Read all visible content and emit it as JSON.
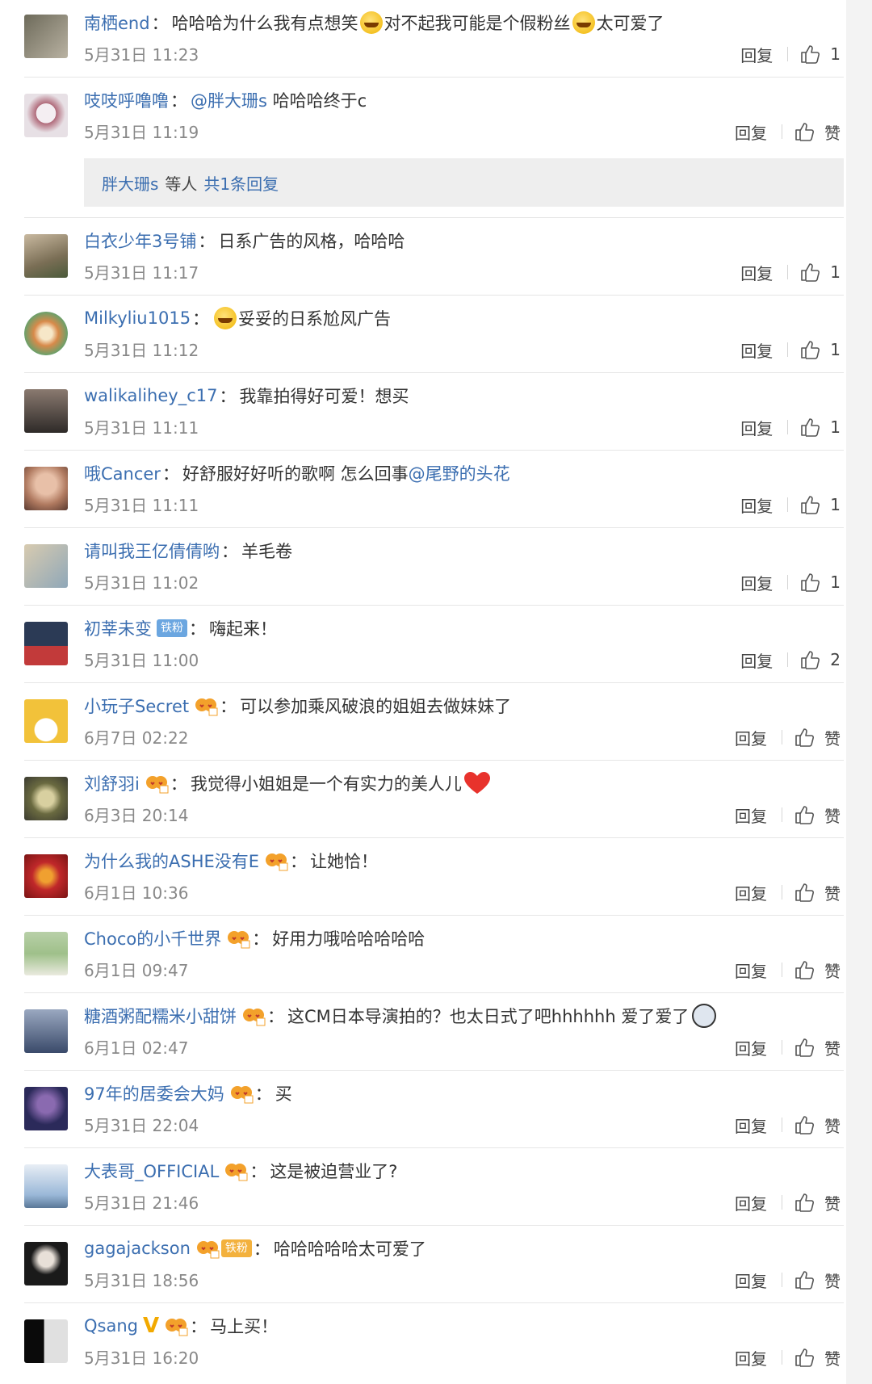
{
  "ui": {
    "reply_label": "回复",
    "like_label": "赞"
  },
  "comments": [
    {
      "user": "南栖end",
      "text": "哈哈哈为什么我有点想笑",
      "text2": "对不起我可能是个假粉丝",
      "text3": "太可爱了",
      "time": "5月31日 11:23",
      "likes": "1",
      "avatar": [
        "#6d6a5a",
        "#b9b2a2"
      ]
    },
    {
      "user": "吱吱呼噜噜",
      "mention": "@胖大珊s",
      "text": " 哈哈哈终于c",
      "time": "5月31日 11:19",
      "likes": "赞",
      "avatar": [
        "#e7e0e5",
        "#b06a7a"
      ],
      "subreply": {
        "user": "胖大珊s",
        "mid": "等人",
        "link": "共1条回复"
      }
    },
    {
      "user": "白衣少年3号铺",
      "text": "日系广告的风格，哈哈哈",
      "time": "5月31日 11:17",
      "likes": "1",
      "avatar": [
        "#7a6e55",
        "#c9b9a0"
      ]
    },
    {
      "user": "Milkyliu1015",
      "text": "妥妥的日系尬风广告",
      "time": "5月31日 11:12",
      "likes": "1",
      "avatar": [
        "#d88a4a",
        "#6aa06a"
      ]
    },
    {
      "user": "walikalihey_c17",
      "text": "我靠拍得好可爱！想买",
      "time": "5月31日 11:11",
      "likes": "1",
      "avatar": [
        "#2e2a28",
        "#8a7a70"
      ]
    },
    {
      "user": "哦Cancer",
      "text": "好舒服好好听的歌啊 怎么回事",
      "mention": "@尾野的头花",
      "time": "5月31日 11:11",
      "likes": "1",
      "avatar": [
        "#b07a60",
        "#e8c0a8"
      ]
    },
    {
      "user": "请叫我王亿倩倩哟",
      "text": "羊毛卷",
      "time": "5月31日 11:02",
      "likes": "1",
      "avatar": [
        "#8fa7b8",
        "#d8cbb0"
      ]
    },
    {
      "user": "初莘未变",
      "badge": "铁粉",
      "text": "嗨起来！",
      "time": "5月31日 11:00",
      "likes": "2",
      "avatar": [
        "#2b3a55",
        "#c23a3a"
      ]
    },
    {
      "user": "小玩子Secret",
      "text": "可以参加乘风破浪的姐姐去做妹妹了",
      "time": "6月7日 02:22",
      "likes": "赞",
      "avatar": [
        "#f2c23a",
        "#ffffff"
      ]
    },
    {
      "user": "刘舒羽i",
      "text": "我觉得小姐姐是一个有实力的美人儿",
      "time": "6月3日 20:14",
      "likes": "赞",
      "avatar": [
        "#3a3a30",
        "#d8d0a0"
      ]
    },
    {
      "user": "为什么我的ASHE没有E",
      "text": "让她恰！",
      "time": "6月1日 10:36",
      "likes": "赞",
      "avatar": [
        "#c0282a",
        "#f0a030"
      ]
    },
    {
      "user": "Choco的小千世界",
      "text": "好用力哦哈哈哈哈哈",
      "time": "6月1日 09:47",
      "likes": "赞",
      "avatar": [
        "#9fc08a",
        "#eaeadf"
      ]
    },
    {
      "user": "糖酒粥配糯米小甜饼",
      "text": "这CM日本导演拍的？也太日式了吧hhhhhh 爱了爱了",
      "time": "6月1日 02:47",
      "likes": "赞",
      "avatar": [
        "#3a4a6a",
        "#9aa8c0"
      ]
    },
    {
      "user": "97年的居委会大妈",
      "text": "买",
      "time": "5月31日 22:04",
      "likes": "赞",
      "avatar": [
        "#2b2a5a",
        "#8a6ab0"
      ]
    },
    {
      "user": "大表哥_OFFICIAL",
      "text": "这是被迫营业了?",
      "time": "5月31日 21:46",
      "likes": "赞",
      "avatar": [
        "#9ab8d8",
        "#e8eef5"
      ]
    },
    {
      "user": "gagajackson",
      "badge": "铁粉",
      "text": "哈哈哈哈哈太可爱了",
      "time": "5月31日 18:56",
      "likes": "赞",
      "avatar": [
        "#1a1a1a",
        "#e8e0d8"
      ]
    },
    {
      "user": "Qsang",
      "text": "马上买！",
      "time": "5月31日 16:20",
      "likes": "赞",
      "avatar": [
        "#0a0a0a",
        "#e0e0e0"
      ]
    }
  ]
}
